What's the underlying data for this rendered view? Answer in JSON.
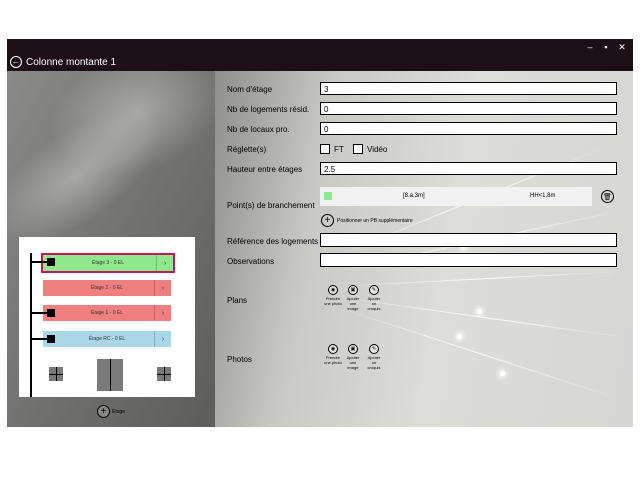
{
  "window": {
    "title": "Colonne montante 1",
    "controls": [
      "–",
      "▪",
      "✕"
    ]
  },
  "floors": [
    {
      "label": "Étage 3 - 0 EL",
      "color": "#8fe88c",
      "selected": true,
      "has_node": true
    },
    {
      "label": "Étage 2 - 0 EL",
      "color": "#f08080",
      "selected": false,
      "has_node": false
    },
    {
      "label": "Étage 1 - 0 EL",
      "color": "#f08080",
      "selected": false,
      "has_node": true
    },
    {
      "label": "Étage RC - 0 EL",
      "color": "#a8d8e8",
      "selected": false,
      "has_node": true
    }
  ],
  "floors_chevron": "›",
  "add_floor_label": "Étage",
  "form": {
    "nom_etage": {
      "label": "Nom d'étage",
      "value": "3"
    },
    "nb_logements": {
      "label": "Nb de logements résid.",
      "value": "0"
    },
    "nb_locaux": {
      "label": "Nb de locaux pro.",
      "value": "0"
    },
    "reglettes": {
      "label": "Réglette(s)",
      "opt1": "FT",
      "opt2": "Vidéo"
    },
    "hauteur": {
      "label": "Hauteur entre étages",
      "value": "2.5"
    },
    "points": {
      "label": "Point(s) de branchement",
      "pb_text1": "[8.a.3m]",
      "pb_text2": "HH<1.8m",
      "add_label": "Positionner un PB supplémentaire"
    },
    "reference": {
      "label": "Référence des logements",
      "value": ""
    },
    "observations": {
      "label": "Observations",
      "value": ""
    },
    "plans": {
      "label": "Plans"
    },
    "photos": {
      "label": "Photos"
    }
  },
  "actions": {
    "take": "Prendre une photo",
    "add_image": "Ajouter une image",
    "add_sketch": "Ajouter un croquis"
  },
  "colors": {
    "titlebar": "#1c1016",
    "selected_border": "#c2185b"
  }
}
